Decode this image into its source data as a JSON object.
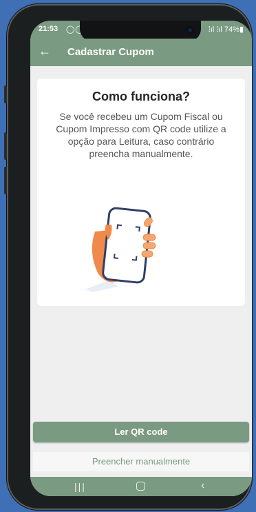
{
  "status": {
    "time": "21:53",
    "notif_icons": "◯◯",
    "right": "⁞ıl ⁞ıl 74%▮"
  },
  "appbar": {
    "back_icon": "back-arrow-icon",
    "title": "Cadastrar Cupom"
  },
  "card": {
    "title": "Como funciona?",
    "description": "Se você recebeu um Cupom Fiscal ou Cupom Impresso com QR code utilize a opção para Leitura, caso contrário preencha manualmente."
  },
  "actions": {
    "scan_label": "Ler QR code",
    "manual_label": "Preencher manualmente"
  },
  "navbar": {
    "recent": "|||",
    "back": "‹"
  },
  "colors": {
    "primary": "#7a9a82",
    "background": "#efefef",
    "card": "#ffffff",
    "phone_frame": "#1c1f20",
    "page_bg": "#3f6fb4"
  }
}
